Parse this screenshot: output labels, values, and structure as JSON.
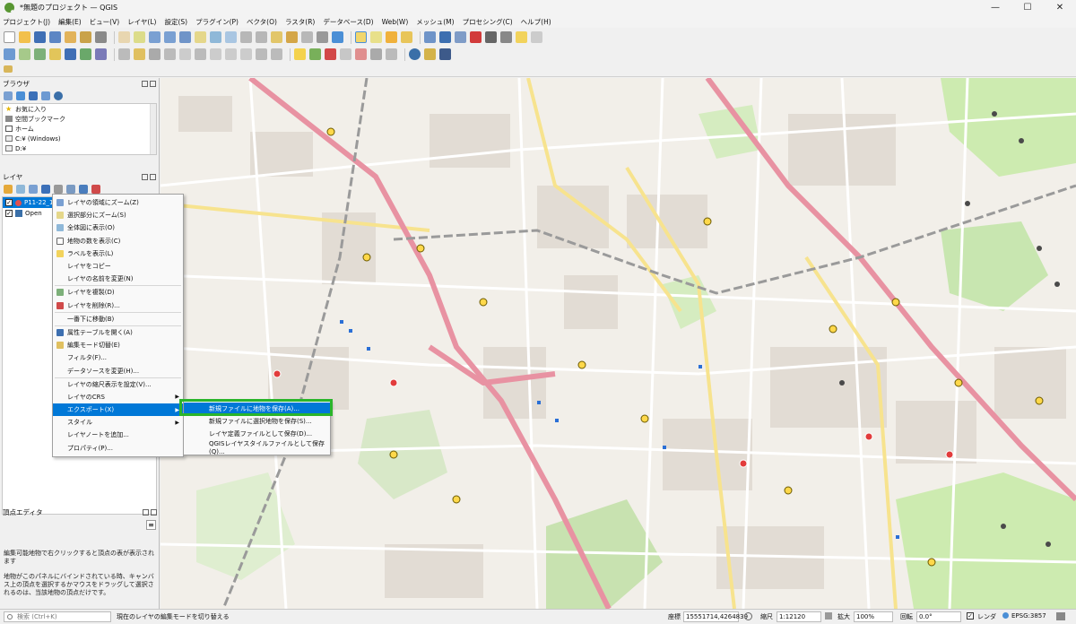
{
  "window": {
    "title": "*無題のプロジェクト — QGIS",
    "controls": [
      "—",
      "☐",
      "✕"
    ]
  },
  "menu": [
    "プロジェクト(J)",
    "編集(E)",
    "ビュー(V)",
    "レイヤ(L)",
    "設定(S)",
    "プラグイン(P)",
    "ベクタ(O)",
    "ラスタ(R)",
    "データベース(D)",
    "Web(W)",
    "メッシュ(M)",
    "プロセシング(C)",
    "ヘルプ(H)"
  ],
  "browser": {
    "title": "ブラウザ",
    "items": [
      "お気に入り",
      "空間ブックマーク",
      "ホーム",
      "C:¥ (Windows)",
      "D:¥"
    ]
  },
  "layers": {
    "title": "レイヤ",
    "items": [
      {
        "name": "P11-22_13",
        "checked": true,
        "selected": true
      },
      {
        "name": "Open",
        "checked": true,
        "selected": false
      }
    ]
  },
  "context_menu": {
    "items": [
      {
        "label": "レイヤの領域にズーム(Z)",
        "icon": "zoom-layer-icon"
      },
      {
        "label": "選択部分にズーム(S)",
        "icon": "zoom-selection-icon"
      },
      {
        "label": "全体図に表示(O)",
        "icon": "overview-icon"
      },
      {
        "label": "地物の数を表示(C)",
        "icon": "checkbox-icon"
      },
      {
        "label": "ラベルを表示(L)",
        "icon": "label-icon"
      },
      {
        "label": "レイヤをコピー",
        "icon": ""
      },
      {
        "label": "レイヤの名前を変更(N)",
        "icon": ""
      },
      {
        "label": "レイヤを複製(D)",
        "icon": "duplicate-icon"
      },
      {
        "label": "レイヤを削除(R)...",
        "icon": "remove-icon"
      },
      {
        "label": "一番下に移動(B)",
        "icon": ""
      },
      {
        "label": "属性テーブルを開く(A)",
        "icon": "table-icon"
      },
      {
        "label": "編集モード切替(E)",
        "icon": "pencil-icon"
      },
      {
        "label": "フィルタ(F)...",
        "icon": ""
      },
      {
        "label": "データソースを変更(H)...",
        "icon": ""
      },
      {
        "label": "レイヤの縮尺表示を設定(V)...",
        "icon": ""
      },
      {
        "label": "レイヤのCRS",
        "icon": "",
        "submenu": true
      },
      {
        "label": "エクスポート(X)",
        "icon": "",
        "submenu": true,
        "highlighted": true
      },
      {
        "label": "スタイル",
        "icon": "",
        "submenu": true
      },
      {
        "label": "レイヤノートを追加...",
        "icon": ""
      },
      {
        "label": "プロパティ(P)...",
        "icon": ""
      }
    ]
  },
  "export_submenu": {
    "items": [
      {
        "label": "新規ファイルに地物を保存(A)...",
        "highlighted": true
      },
      {
        "label": "新規ファイルに選択地物を保存(S)...",
        "highlighted": false
      },
      {
        "label": "レイヤ定義ファイルとして保存(D)...",
        "highlighted": false
      },
      {
        "label": "QGISレイヤスタイルファイルとして保存(Q)...",
        "highlighted": false
      }
    ]
  },
  "vertex_editor": {
    "title": "頂点エディタ",
    "text1": "編集可能地物で右クリックすると頂点の表が表示されます",
    "text2": "地物がこのパネルにバインドされている時、キャンバス上の頂点を選択するかマウスをドラッグして選択されるのは、当該地物の頂点だけです。"
  },
  "statusbar": {
    "search_placeholder": "検索 (Ctrl+K)",
    "message": "現在のレイヤの編集モードを切り替える",
    "coord_label": "座標",
    "coord_value": "15551714,4264839",
    "scale_label": "縮尺",
    "scale_value": "1:12120",
    "magnifier_label": "拡大",
    "magnifier_value": "100%",
    "rotation_label": "回転",
    "rotation_value": "0.0°",
    "render_label": "レンダ",
    "crs": "EPSG:3857"
  },
  "colors": {
    "accent": "#0078d7",
    "highlight_box": "#2bb52b",
    "qgis_green": "#589632",
    "map_bg": "#f2efe9",
    "major_road": "#e892a2",
    "railway": "#999999"
  }
}
